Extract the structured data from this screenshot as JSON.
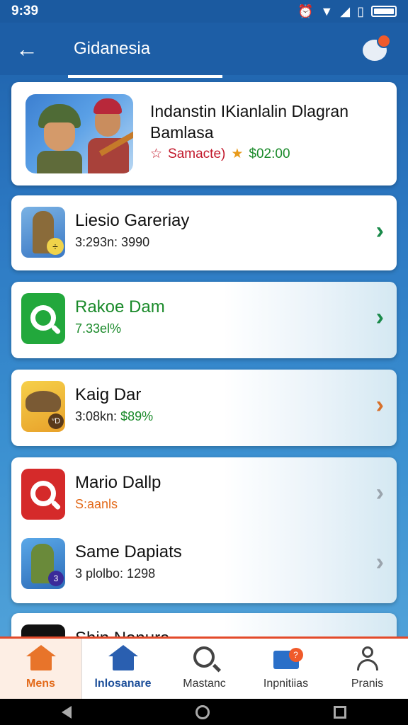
{
  "status_bar": {
    "time": "9:39"
  },
  "app_bar": {
    "title": "Gidanesia",
    "back_icon": "arrow-left-icon",
    "chat_icon": "chat-bubble-icon"
  },
  "featured": {
    "title": "Indanstin IKianlalin Dlagran Bamlasa",
    "meta_left": "Samacte)",
    "meta_right": "$02:00"
  },
  "list": [
    {
      "title": "Liesio Gareriay",
      "subtitle": "3:293n: 3990",
      "subtitle_color": "#222222",
      "chevron_color": "#1a8a4a",
      "icon": "soldier-icon",
      "badge": "÷"
    },
    {
      "title": "Rakoe Dam",
      "subtitle": "7.33el%",
      "title_color": "#1a8a2a",
      "subtitle_color": "#1a8a2a",
      "chevron_color": "#1a8a4a",
      "icon": "search-app-icon"
    },
    {
      "title": "Kaig Dar",
      "subtitle_prefix": "3:08kn:",
      "subtitle_value": "$89%",
      "chevron_color": "#d7702a",
      "icon": "eagle-icon",
      "badge": "ᐡD"
    },
    {
      "title": "Mario Dallp",
      "subtitle": "S:aanls",
      "subtitle_color": "#e36a1a",
      "chevron_color": "#9aa4ad",
      "icon": "red-search-app-icon"
    },
    {
      "title": "Same Dapiats",
      "subtitle": "3 plolbo: 1298",
      "chevron_color": "#9aa4ad",
      "icon": "hero-icon",
      "badge": "3"
    },
    {
      "title": "Shin Nonura",
      "icon": "dark-app-icon"
    }
  ],
  "bottom_nav": [
    {
      "label": "Mens",
      "icon": "home-icon"
    },
    {
      "label": "lnlosanare",
      "icon": "home-icon"
    },
    {
      "label": "Mastanc",
      "icon": "search-icon"
    },
    {
      "label": "Inpnitiias",
      "icon": "mail-icon",
      "badge": "?"
    },
    {
      "label": "Pranis",
      "icon": "person-icon"
    }
  ],
  "colors": {
    "app_bar": "#1d5ea6",
    "accent_orange": "#e36a1a",
    "accent_green": "#1a8a2a",
    "accent_red": "#c2182b"
  }
}
